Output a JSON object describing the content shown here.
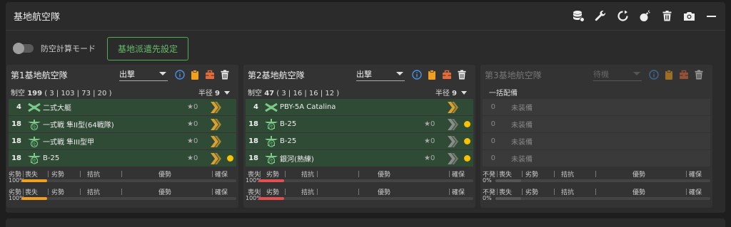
{
  "header": {
    "title": "基地航空隊",
    "icons": [
      "database-icon",
      "wrench-icon",
      "refresh-icon",
      "bomb-icon",
      "trash-icon",
      "camera-icon",
      "minimize-icon"
    ]
  },
  "toolbar": {
    "toggle_label": "防空計算モード",
    "toggle_on": false,
    "dispatch_button": "基地派遣先設定"
  },
  "colors": {
    "accent_green": "#4caf50",
    "warn_yellow": "#f9c200",
    "orange": "#f0a020",
    "red": "#e05050"
  },
  "corps": [
    {
      "name": "第1基地航空隊",
      "mode": "出撃",
      "air_power_label": "制空",
      "air_power": "199",
      "air_power_detail": "( 3 | 103 | 73 | 20 )",
      "radius_label": "半径",
      "radius": "9",
      "slots": [
        {
          "count": "4",
          "plane": "二式大艇",
          "star": "★0",
          "icon": "flying-boat-icon",
          "chev": "orange",
          "dot": false
        },
        {
          "count": "18",
          "plane": "一式戦 隼II型(64戦隊)",
          "star": "★0",
          "icon": "fighter-icon",
          "chev": "orange",
          "dot": false
        },
        {
          "count": "18",
          "plane": "一式戦 隼III型甲",
          "star": "★0",
          "icon": "fighter-icon",
          "chev": "orange",
          "dot": false
        },
        {
          "count": "18",
          "plane": "B-25",
          "star": "★0",
          "icon": "bomber-icon",
          "chev": "orange",
          "dot": true
        }
      ],
      "bars": [
        {
          "labels": [
            "劣勢",
            "喪失",
            "劣勢",
            "拮抗",
            "優勢",
            "確保"
          ],
          "percent": "100%",
          "fill_color": "#f0a020"
        },
        {
          "labels": [
            "劣勢",
            "喪失",
            "劣勢",
            "拮抗",
            "優勢",
            "確保"
          ],
          "percent": "100%",
          "fill_color": "#f0a020"
        }
      ]
    },
    {
      "name": "第2基地航空隊",
      "mode": "出撃",
      "air_power_label": "制空",
      "air_power": "47",
      "air_power_detail": "( 3 | 16 | 16 | 12 )",
      "radius_label": "半径",
      "radius": "9",
      "slots": [
        {
          "count": "4",
          "plane": "PBY-5A Catalina",
          "star": "",
          "icon": "flying-boat-icon",
          "chev": "orange",
          "dot": false
        },
        {
          "count": "18",
          "plane": "B-25",
          "star": "★0",
          "icon": "bomber-icon",
          "chev": "grey",
          "dot": true
        },
        {
          "count": "18",
          "plane": "B-25",
          "star": "★0",
          "icon": "bomber-icon",
          "chev": "grey",
          "dot": true
        },
        {
          "count": "18",
          "plane": "銀河(熟練)",
          "star": "★0",
          "icon": "bomber-icon",
          "chev": "grey",
          "dot": true
        }
      ],
      "bars": [
        {
          "labels": [
            "喪失",
            "劣勢",
            "拮抗",
            "優勢",
            "確保"
          ],
          "percent": "100%",
          "fill_color": "#e05050"
        },
        {
          "labels": [
            "喪失",
            "劣勢",
            "拮抗",
            "優勢",
            "確保"
          ],
          "percent": "100%",
          "fill_color": "#e05050"
        }
      ]
    },
    {
      "name": "第3基地航空隊",
      "mode": "待機",
      "air_power_label": "一括配備",
      "slots": [
        {
          "count": "0",
          "plane": "未装備"
        },
        {
          "count": "0",
          "plane": "未装備"
        },
        {
          "count": "0",
          "plane": "未装備"
        },
        {
          "count": "0",
          "plane": "未装備"
        }
      ],
      "bars": [
        {
          "labels": [
            "不発",
            "喪失",
            "劣勢",
            "拮抗",
            "優勢",
            "確保"
          ],
          "percent": "0%",
          "fill_color": "#555"
        },
        {
          "labels": [
            "不発",
            "喪失",
            "劣勢",
            "拮抗",
            "優勢",
            "確保"
          ],
          "percent": "0%",
          "fill_color": "#555"
        }
      ]
    }
  ]
}
